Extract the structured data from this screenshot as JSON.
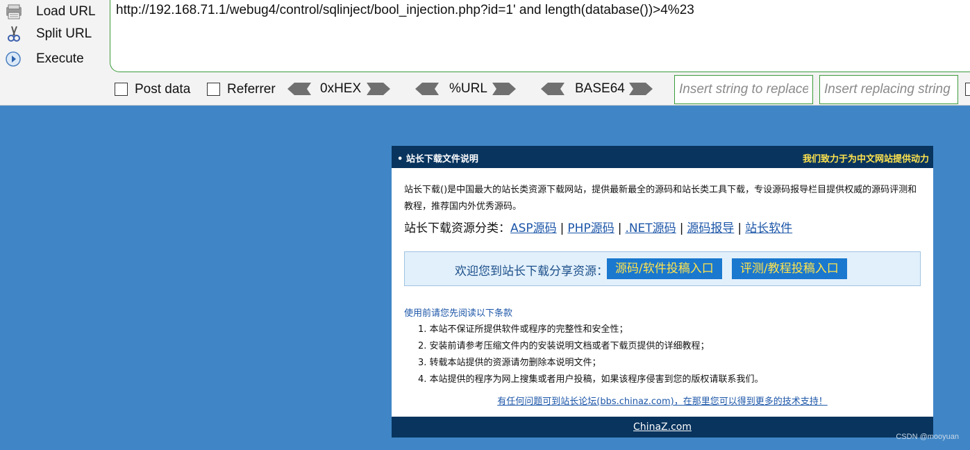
{
  "toolbar": {
    "load_url": "Load URL",
    "split_url": "Split URL",
    "execute": "Execute",
    "url_value": "http://192.168.71.1/webug4/control/sqlinject/bool_injection.php?id=1' and length(database())>4%23",
    "post_data": "Post data",
    "referrer": "Referrer",
    "hex": "0xHEX",
    "url_enc": "%URL",
    "base64": "BASE64",
    "replace_placeholder": "Insert string to replace",
    "replacing_placeholder": "Insert replacing string",
    "colors": {
      "border_green": "#3a9a3a",
      "arrow_gray": "#707070"
    }
  },
  "page": {
    "header_title": "• 站长下载文件说明",
    "header_slogan": "我们致力于为中文网站提供动力",
    "intro": "站长下载()是中国最大的站长类资源下载网站，提供最新最全的源码和站长类工具下载，专设源码报导栏目提供权威的源码评测和教程，推荐国内外优秀源码。",
    "categories_label": "站长下载资源分类：",
    "categories": [
      "ASP源码",
      "PHP源码",
      ".NET源码",
      "源码报导",
      "站长软件"
    ],
    "separator": "|",
    "share_label": "欢迎您到站长下载分享资源：",
    "share_buttons": [
      "源码/软件投稿入口",
      "评测/教程投稿入口"
    ],
    "terms_title": "使用前请您先阅读以下条款",
    "terms": [
      "1. 本站不保证所提供软件或程序的完整性和安全性；",
      "2. 安装前请参考压缩文件内的安装说明文档或者下载页提供的详细教程；",
      "3. 转载本站提供的资源请勿删除本说明文件；",
      "4. 本站提供的程序为网上搜集或者用户投稿，如果该程序侵害到您的版权请联系我们。"
    ],
    "forum_link": "有任何问题可到站长论坛(bbs.chinaz.com)，在那里您可以得到更多的技术支持！",
    "footer_link": "ChinaZ.com",
    "colors": {
      "background": "#4086c6",
      "header_bg": "#08345e",
      "slogan": "#ffe34d",
      "link": "#1c56a8"
    }
  },
  "watermark": "CSDN @mooyuan"
}
